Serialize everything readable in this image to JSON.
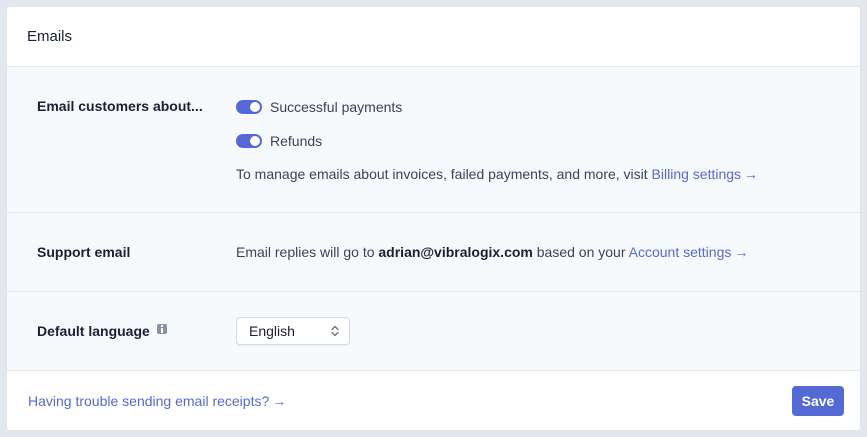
{
  "header": {
    "title": "Emails"
  },
  "notifications": {
    "label": "Email customers about...",
    "toggles": [
      {
        "label": "Successful payments",
        "enabled": true
      },
      {
        "label": "Refunds",
        "enabled": true
      }
    ],
    "note_prefix": "To manage emails about invoices, failed payments, and more, visit ",
    "note_link": "Billing settings",
    "arrow": "→"
  },
  "support": {
    "label": "Support email",
    "text_prefix": "Email replies will go to ",
    "email": "adrian@vibralogix.com",
    "text_middle": " based on your ",
    "link": "Account settings",
    "arrow": "→"
  },
  "language": {
    "label": "Default language",
    "selected": "English",
    "info_icon": "info-icon"
  },
  "footer": {
    "help_link": "Having trouble sending email receipts?",
    "arrow": "→",
    "save_label": "Save"
  },
  "colors": {
    "accent": "#5469d4",
    "background": "#f7fafc",
    "text": "#3c4257"
  }
}
